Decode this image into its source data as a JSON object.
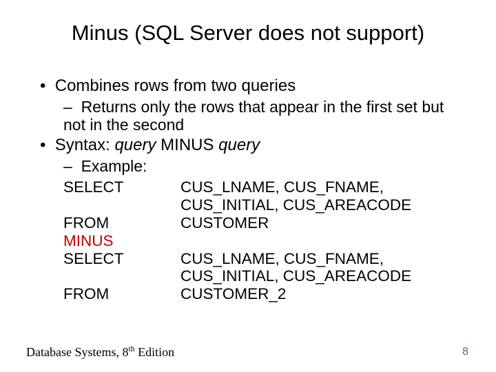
{
  "title": "Minus (SQL Server does not support)",
  "bullet1": "•  Combines rows from two queries",
  "dash1": "–  Returns only the rows that appear in the first set but not in the second",
  "bullet2_prefix": "•  Syntax: ",
  "bullet2_q1": "query",
  "bullet2_minus": " MINUS ",
  "bullet2_q2": "query",
  "dash2": "–  Example:",
  "sql": {
    "kw_select1": "SELECT",
    "cols1a": "CUS_LNAME, CUS_FNAME,",
    "cols1b": "CUS_INITIAL, CUS_AREACODE",
    "kw_from1": "FROM",
    "tbl1": "CUSTOMER",
    "kw_minus": "MINUS",
    "kw_select2": "SELECT",
    "cols2a": "CUS_LNAME, CUS_FNAME,",
    "cols2b": "CUS_INITIAL, CUS_AREACODE",
    "kw_from2": "FROM",
    "tbl2": "CUSTOMER_2"
  },
  "footer": {
    "left_a": "Database Systems, 8",
    "left_sup": "th",
    "left_b": " Edition",
    "page": "8"
  }
}
